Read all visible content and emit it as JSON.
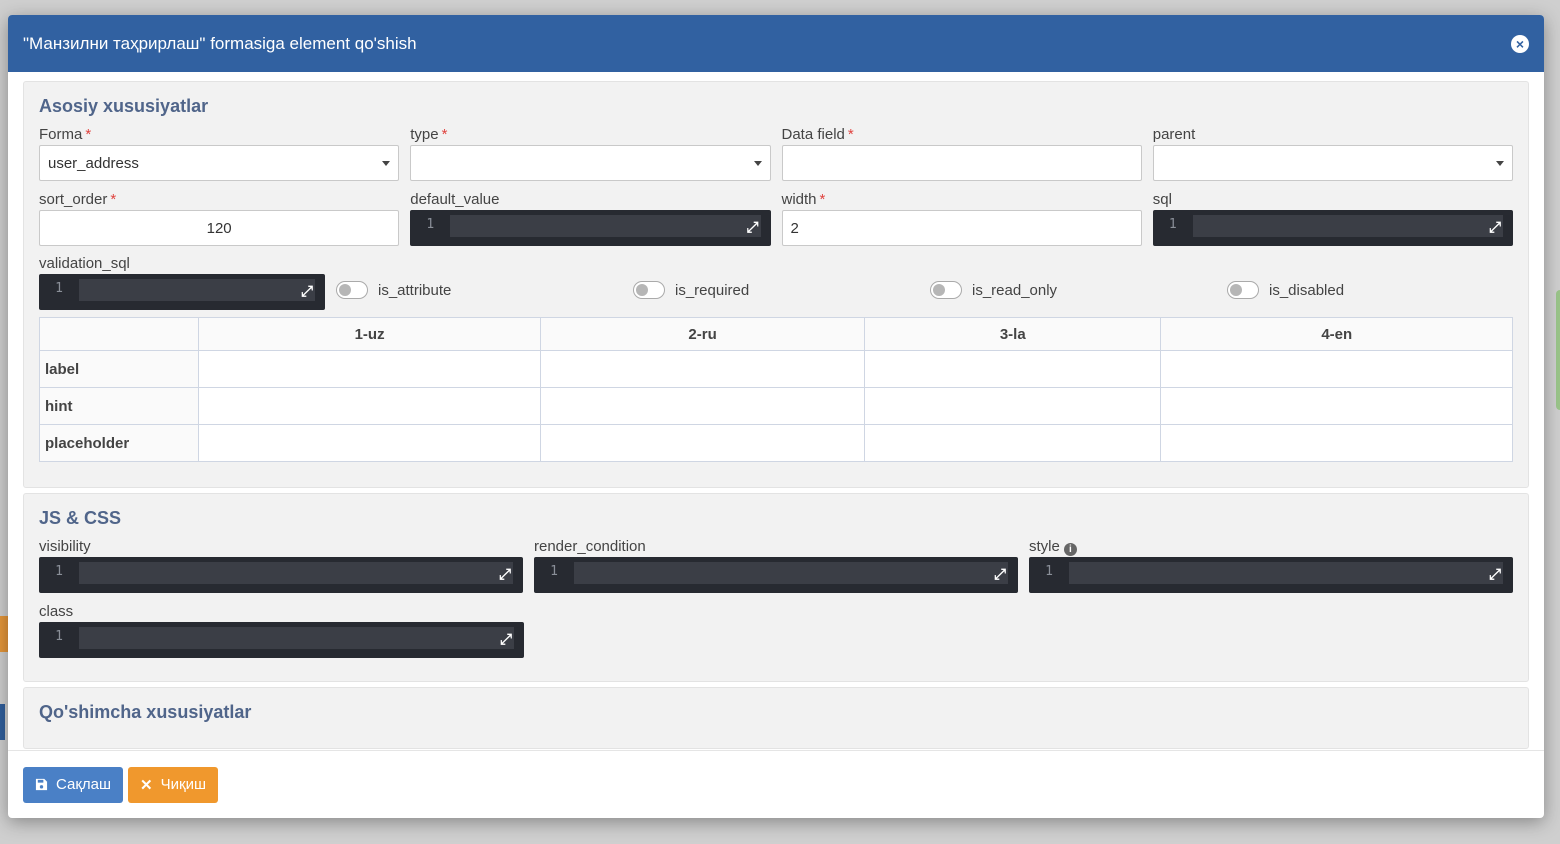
{
  "modal": {
    "title": "\"Манзилни таҳрирлаш\" formasiga element qo'shish",
    "close_icon": "×"
  },
  "basic": {
    "title": "Asosiy xususiyatlar",
    "forma": {
      "label": "Forma",
      "value": "user_address"
    },
    "type": {
      "label": "type",
      "value": ""
    },
    "data_field": {
      "label": "Data field",
      "value": ""
    },
    "parent": {
      "label": "parent",
      "value": ""
    },
    "sort_order": {
      "label": "sort_order",
      "value": "120"
    },
    "default_value": {
      "label": "default_value",
      "line": "1"
    },
    "width": {
      "label": "width",
      "value": "2"
    },
    "sql": {
      "label": "sql",
      "line": "1"
    },
    "validation_sql": {
      "label": "validation_sql",
      "line": "1"
    },
    "toggles": {
      "is_attribute": "is_attribute",
      "is_required": "is_required",
      "is_read_only": "is_read_only",
      "is_disabled": "is_disabled"
    },
    "table": {
      "columns": [
        "",
        "1-uz",
        "2-ru",
        "3-la",
        "4-en"
      ],
      "rows": [
        "label",
        "hint",
        "placeholder"
      ]
    }
  },
  "jscss": {
    "title": "JS & CSS",
    "visibility": {
      "label": "visibility",
      "line": "1"
    },
    "render_condition": {
      "label": "render_condition",
      "line": "1"
    },
    "style": {
      "label": "style",
      "line": "1"
    },
    "class": {
      "label": "class",
      "line": "1"
    }
  },
  "extra": {
    "title": "Qo'shimcha xususiyatlar"
  },
  "footer": {
    "save_label": "Сақлаш",
    "exit_label": "Чиқиш"
  },
  "colors": {
    "header": "#3161a1",
    "save": "#4a80c6",
    "exit": "#f0982d",
    "editor": "#272a31"
  }
}
